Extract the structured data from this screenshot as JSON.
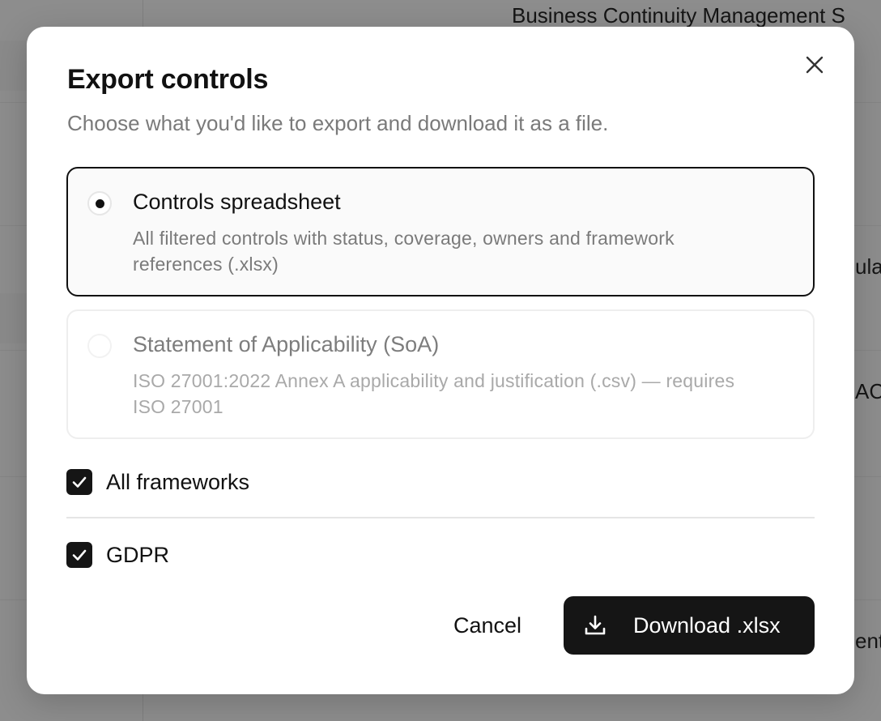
{
  "background": {
    "page_title_fragment": "Business Continuity Management S",
    "fragments": [
      "ula",
      "AC)",
      "ent"
    ]
  },
  "dialog": {
    "title": "Export controls",
    "subtitle": "Choose what you'd like to export and download it as a file.",
    "close_icon": "close-icon",
    "options": [
      {
        "title": "Controls spreadsheet",
        "description": "All filtered controls with status, coverage, owners and framework references (.xlsx)",
        "selected": true,
        "disabled": false
      },
      {
        "title": "Statement of Applicability (SoA)",
        "description": "ISO 27001:2022 Annex A applicability and justification (.csv) — requires ISO 27001",
        "selected": false,
        "disabled": true
      }
    ],
    "checkboxes": [
      {
        "label": "All frameworks",
        "checked": true
      },
      {
        "label": "GDPR",
        "checked": true
      }
    ],
    "cancel_label": "Cancel",
    "download_label": "Download .xlsx",
    "download_icon": "download-icon"
  },
  "colors": {
    "primary": "#151515",
    "muted_text": "#7a7a7a",
    "disabled_text": "#a9a9a9",
    "overlay": "#8d8d8d"
  }
}
